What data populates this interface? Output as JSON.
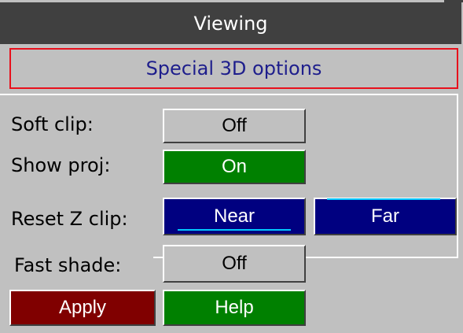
{
  "title": "Viewing",
  "section": {
    "heading": "Special 3D options"
  },
  "options": {
    "soft_clip": {
      "label": "Soft clip:",
      "value": "Off"
    },
    "show_proj": {
      "label": "Show proj:",
      "value": "On"
    },
    "reset_z_clip": {
      "label": "Reset Z clip:",
      "near_label": "Near",
      "far_label": "Far"
    },
    "fast_shade": {
      "label": "Fast shade:",
      "value": "Off"
    }
  },
  "actions": {
    "apply_label": "Apply",
    "help_label": "Help"
  },
  "colors": {
    "title_bg": "#404040",
    "panel_bg": "#c0c0c0",
    "heading_border": "#e8101c",
    "heading_text": "#1e1e8c",
    "on_green": "#008000",
    "near_far_navy": "#000080",
    "apply_maroon": "#800000",
    "selected_indicator": "#00c8ff"
  }
}
